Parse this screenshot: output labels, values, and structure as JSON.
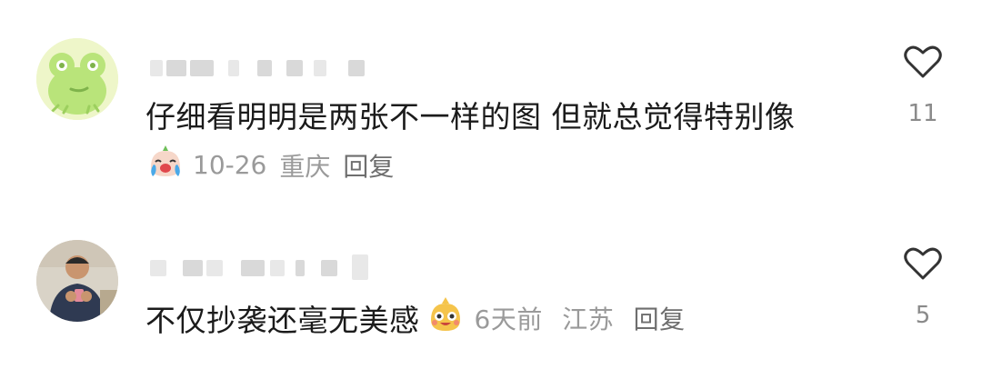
{
  "comments": [
    {
      "text": "仔细看明明是两张不一样的图 但就总觉得特别像",
      "date": "10-26",
      "location": "重庆",
      "reply_label": "回复",
      "likes": "11",
      "avatar_icon": "green-frog-avatar-icon",
      "emoji_icon": "crying-emoji-icon"
    },
    {
      "text": "不仅抄袭还毫无美感",
      "date": "6天前",
      "location": "江苏",
      "reply_label": "回复",
      "likes": "5",
      "avatar_icon": "man-photo-avatar-icon",
      "emoji_icon": "smiling-emoji-icon"
    }
  ],
  "colors": {
    "text": "#1b1b1b",
    "meta": "#9a9a9a",
    "reply": "#6e6e6e",
    "blur": "#d9d9d9"
  }
}
